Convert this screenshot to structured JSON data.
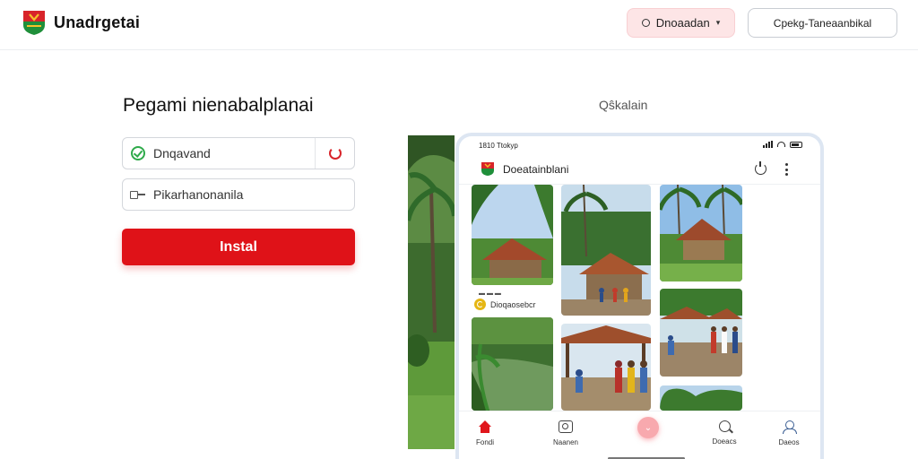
{
  "header": {
    "brand_name": "Unadrgetai",
    "download_label": "Dnoaadan",
    "secondary_label": "Cpekg‑Taneaanbikal"
  },
  "form": {
    "title": "Pegami nienabalplanai",
    "field1_value": "Dnqavand",
    "field2_value": "Pikarhanonanila",
    "install_label": "Instal"
  },
  "preview": {
    "search_label": "Qŝkalain",
    "phone": {
      "time": "1810 Ttokyp",
      "app_title": "Doeatainblani",
      "caption": "Dioqaosebcr",
      "nav": [
        "Fondi",
        "Naanen",
        "Doeacs",
        "Daeos"
      ]
    }
  },
  "colors": {
    "accent": "#df1218",
    "download_bg": "#fde5e6",
    "success": "#2eaa4a",
    "phone_frame": "#dde6f2"
  },
  "icons": [
    "logo-shield-icon",
    "chevron-down-icon",
    "check-circle-icon",
    "refresh-icon",
    "key-icon",
    "power-icon",
    "more-vertical-icon",
    "home-icon",
    "camera-icon",
    "search-icon",
    "user-icon"
  ]
}
